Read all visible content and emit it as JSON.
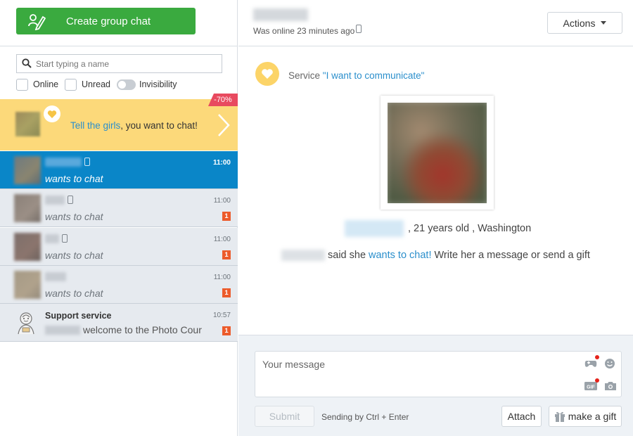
{
  "sidebar": {
    "create_label": "Create group chat",
    "search_placeholder": "Start typing a name",
    "filters": {
      "online": "Online",
      "unread": "Unread",
      "invisibility": "Invisibility"
    },
    "promo": {
      "link_text": "Tell the girls",
      "rest_text": ", you want to chat!",
      "discount": "-70%"
    },
    "chats": [
      {
        "message": "wants to chat",
        "time": "11:00",
        "unread": ""
      },
      {
        "message": "wants to chat",
        "time": "11:00",
        "unread": "1"
      },
      {
        "message": "wants to chat",
        "time": "11:00",
        "unread": "1"
      },
      {
        "message": "wants to chat",
        "time": "11:00",
        "unread": "1"
      },
      {
        "name": "Support service",
        "message": "welcome to the Photo Cour",
        "time": "10:57",
        "unread": "1"
      }
    ]
  },
  "header": {
    "status": "Was online 23 minutes ago",
    "actions_label": "Actions"
  },
  "main": {
    "service_prefix": "Service ",
    "service_link": "\"I want to communicate\"",
    "profile_info": ", 21 years old , Washington",
    "said_prefix": "said she ",
    "said_link": "wants to chat!",
    "said_suffix": " Write her a message or send a gift"
  },
  "composer": {
    "placeholder": "Your message",
    "submit_label": "Submit",
    "hint": "Sending by Ctrl + Enter",
    "attach_label": "Attach",
    "gift_label": "make a gift"
  },
  "colors": {
    "accent": "#0a86c8",
    "green": "#3aaa3f",
    "promo": "#fcd97a",
    "badge": "#ec5b2b"
  }
}
